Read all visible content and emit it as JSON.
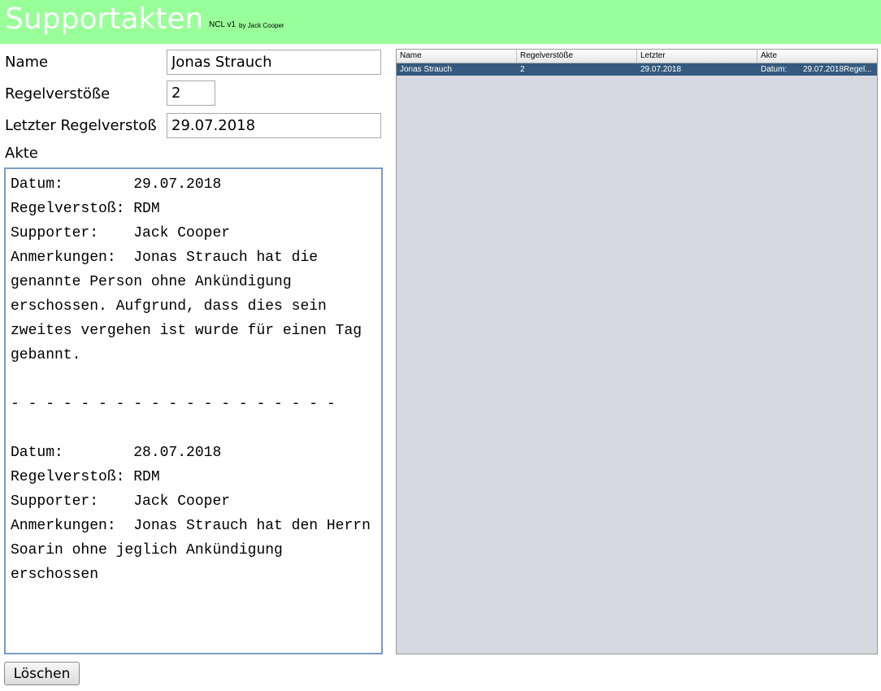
{
  "header": {
    "title": "Supportakten",
    "version": "NCL v1",
    "author": "by Jack Cooper",
    "color": "#99ff99"
  },
  "form": {
    "name_label": "Name",
    "name_value": "Jonas Strauch",
    "regelverstoesse_label": "Regelverstöße",
    "regelverstoesse_value": "2",
    "letzter_label": "Letzter Regelverstoß",
    "letzter_value": "29.07.2018",
    "akte_label": "Akte",
    "akte_text": "Datum:        29.07.2018\nRegelverstoß: RDM\nSupporter:    Jack Cooper\nAnmerkungen:  Jonas Strauch hat die genannte Person ohne Ankündigung erschossen. Aufgrund, dass dies sein zweites vergehen ist wurde für einen Tag gebannt.\n\n- - - - - - - - - - - - - - - - - - -\n\nDatum:        28.07.2018\nRegelverstoß: RDM\nSupporter:    Jack Cooper\nAnmerkungen:  Jonas Strauch hat den Herrn Soarin ohne jeglich Ankündigung erschossen",
    "delete_label": "Löschen"
  },
  "table": {
    "columns": [
      "Name",
      "Regelverstöße",
      "Letzter",
      "Akte"
    ],
    "rows": [
      {
        "name": "Jonas Strauch",
        "regelverstoesse": "2",
        "letzter": "29.07.2018",
        "akte_prefix": "Datum:",
        "akte_rest": "29.07.2018Regel..."
      }
    ],
    "selected_row_color": "#355a7d"
  }
}
